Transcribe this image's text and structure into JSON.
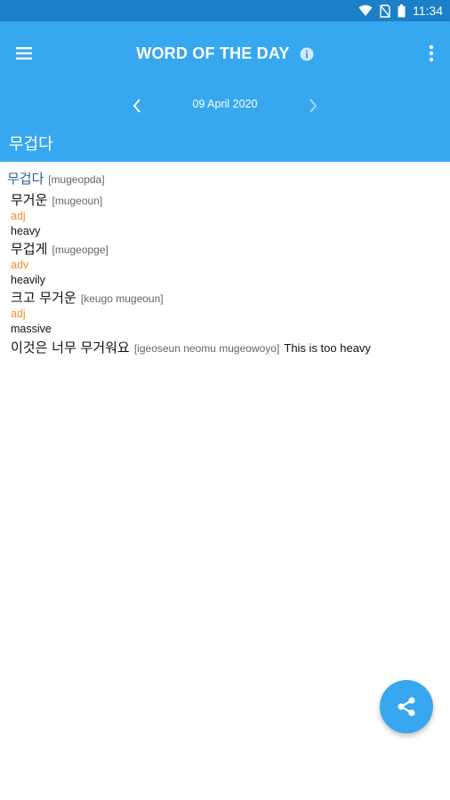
{
  "status_bar": {
    "time": "11:34",
    "icons": [
      "wifi-icon",
      "no-sim-icon",
      "battery-icon"
    ]
  },
  "app_bar": {
    "title": "WORD OF THE DAY",
    "date": "09 April 2020",
    "word": "무겁다",
    "icons": [
      "menu-icon",
      "info-icon",
      "more-vert-icon",
      "chevron-left-icon",
      "chevron-right-icon"
    ]
  },
  "entry": {
    "headword": "무겁다",
    "headword_roman": "[mugeopda]",
    "forms": [
      {
        "korean": "무거운",
        "roman": "[mugeoun]",
        "pos": "adj",
        "gloss": "heavy"
      },
      {
        "korean": "무겁게",
        "roman": "[mugeopge]",
        "pos": "adv",
        "gloss": "heavily"
      },
      {
        "korean": "크고 무거운",
        "roman": "[keugo mugeoun]",
        "pos": "adj",
        "gloss": "massive"
      }
    ],
    "example": {
      "korean": "이것은 너무 무거워요",
      "roman": "[igeoseun neomu mugeowoyo]",
      "translation": "This is too heavy"
    }
  },
  "fab": {
    "icon": "share-icon"
  },
  "colors": {
    "status_bar": "#1b7fc9",
    "app_bar": "#37a7f0",
    "headword": "#2d5f9a",
    "pos": "#f0902a"
  }
}
